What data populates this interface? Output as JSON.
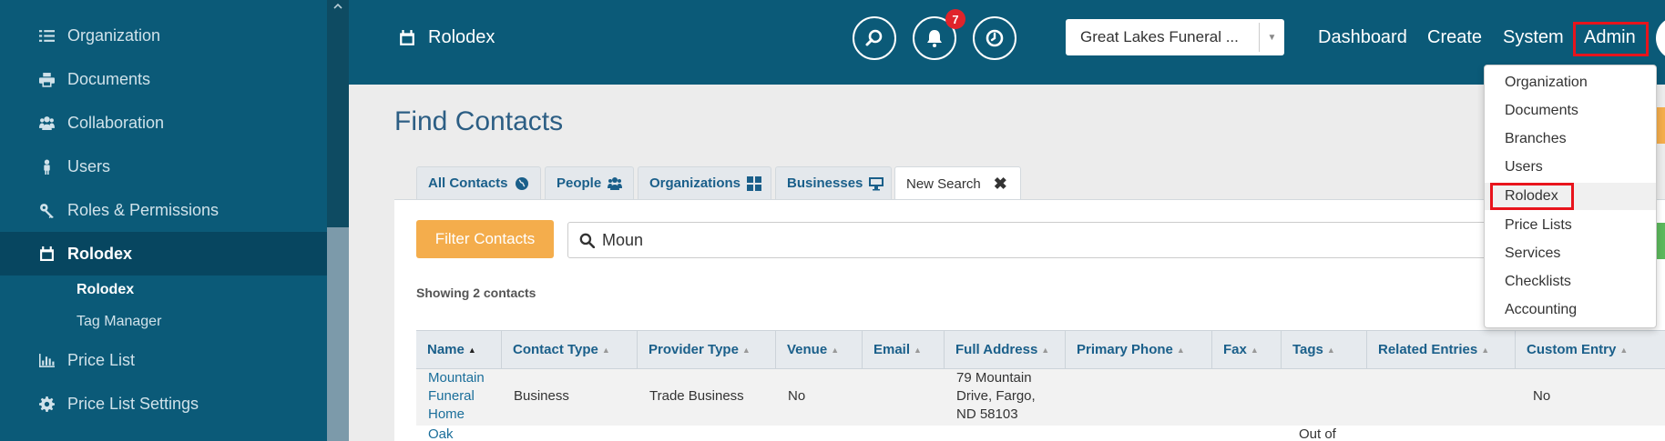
{
  "sidebar": {
    "items": [
      {
        "label": "Organization",
        "icon": "list-icon"
      },
      {
        "label": "Documents",
        "icon": "print-icon"
      },
      {
        "label": "Collaboration",
        "icon": "users-icon"
      },
      {
        "label": "Users",
        "icon": "user-icon"
      },
      {
        "label": "Roles & Permissions",
        "icon": "key-icon"
      },
      {
        "label": "Rolodex",
        "icon": "calendar-icon",
        "active": true
      },
      {
        "label": "Price List",
        "icon": "bar-chart-icon"
      },
      {
        "label": "Price List Settings",
        "icon": "gear-icon"
      }
    ],
    "subitems": [
      {
        "label": "Rolodex",
        "active": true
      },
      {
        "label": "Tag Manager"
      }
    ]
  },
  "header": {
    "title": "Rolodex",
    "notification_count": "7",
    "org_select": "Great Lakes Funeral ...",
    "nav": [
      "Dashboard",
      "Create",
      "System",
      "Admin"
    ]
  },
  "main": {
    "title": "Find Contacts",
    "tabs": [
      {
        "label": "All Contacts",
        "icon": "globe-icon"
      },
      {
        "label": "People",
        "icon": "users-icon"
      },
      {
        "label": "Organizations",
        "icon": "grid-icon"
      },
      {
        "label": "Businesses",
        "icon": "monitor-icon"
      },
      {
        "label": "New Search",
        "icon": "close-icon",
        "active": true
      }
    ],
    "filter_button": "Filter Contacts",
    "search_value": "Moun",
    "showing": "Showing 2 contacts",
    "columns": [
      "Name",
      "Contact Type",
      "Provider Type",
      "Venue",
      "Email",
      "Full Address",
      "Primary Phone",
      "Fax",
      "Tags",
      "Related Entries",
      "Custom Entry"
    ],
    "rows": [
      {
        "name_lines": [
          "Mountain",
          "Funeral",
          "Home"
        ],
        "contact_type": "Business",
        "provider_type": "Trade Business",
        "venue": "No",
        "address_lines": [
          "79 Mountain",
          "Drive, Fargo,",
          "ND 58103"
        ],
        "custom_entry": "No"
      },
      {
        "name_lines": [
          "Oak"
        ],
        "tags_lines": [
          "Out of"
        ]
      }
    ]
  },
  "admin_menu": {
    "items": [
      "Organization",
      "Documents",
      "Branches",
      "Users",
      "Rolodex",
      "Price Lists",
      "Services",
      "Checklists",
      "Accounting"
    ],
    "highlighted": "Rolodex"
  },
  "colors": {
    "brand": "#0b5a78",
    "accent": "#f4ad4c",
    "highlight_box": "#e8141c"
  }
}
